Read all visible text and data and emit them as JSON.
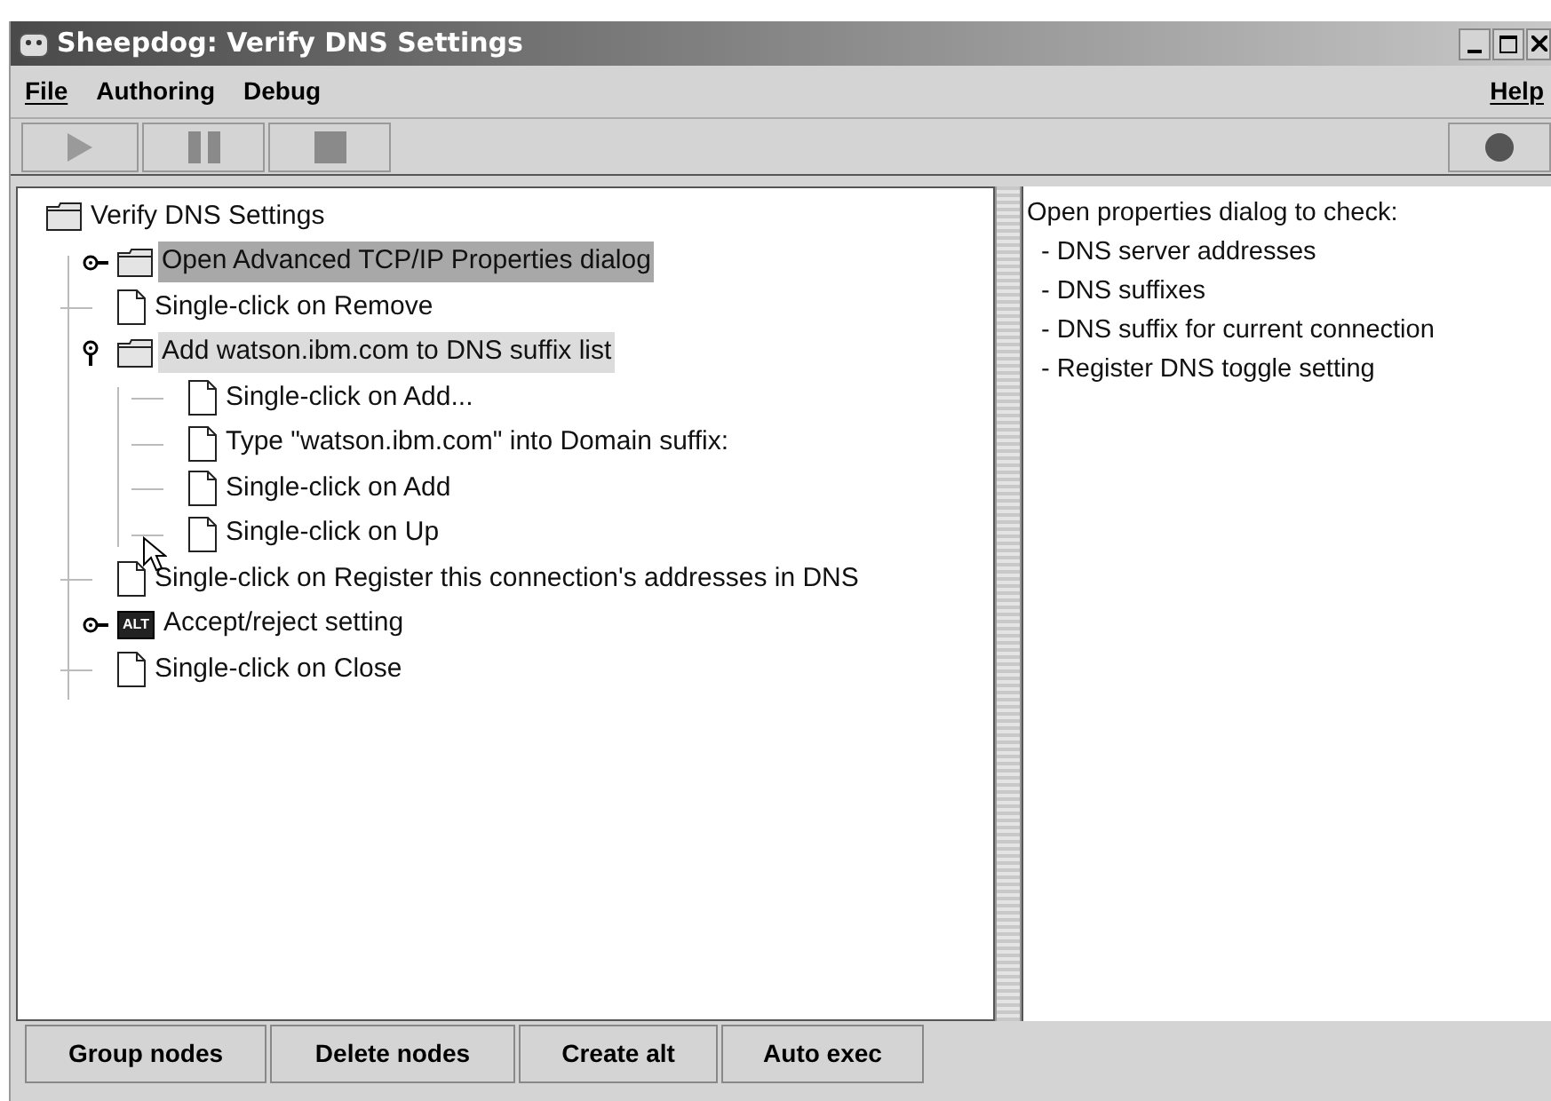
{
  "window": {
    "title": "Sheepdog: Verify DNS Settings"
  },
  "menu": [
    {
      "label": "File",
      "mnemonic": true
    },
    {
      "label": "Authoring",
      "mnemonic": false
    },
    {
      "label": "Debug",
      "mnemonic": false
    }
  ],
  "help_menu": {
    "label": "Help",
    "mnemonic": true
  },
  "tree": {
    "label": "Verify DNS Settings",
    "kind": "folder",
    "children": [
      {
        "label": "Open Advanced TCP/IP Properties dialog",
        "kind": "folder",
        "expanded": false,
        "selected": true,
        "focused": false
      },
      {
        "label": "Single-click on Remove",
        "kind": "step",
        "selected": false,
        "focused": false
      },
      {
        "label": "Add watson.ibm.com to DNS suffix list",
        "kind": "folder",
        "expanded": true,
        "selected": false,
        "focused": true,
        "children": [
          {
            "label": "Single-click on Add...",
            "kind": "step",
            "selected": false,
            "focused": false
          },
          {
            "label": "Type \"watson.ibm.com\" into Domain suffix:",
            "kind": "step",
            "selected": false,
            "focused": false
          },
          {
            "label": "Single-click on Add",
            "kind": "step",
            "selected": false,
            "focused": false
          },
          {
            "label": "Single-click on Up",
            "kind": "step",
            "selected": false,
            "focused": false
          }
        ]
      },
      {
        "label": "Single-click on Register this connection's addresses in DNS",
        "kind": "step",
        "selected": false,
        "focused": false
      },
      {
        "label": "Accept/reject setting",
        "kind": "alt",
        "alt_badge": "ALT",
        "expanded": false,
        "selected": false,
        "focused": false
      },
      {
        "label": "Single-click on Close",
        "kind": "step",
        "selected": false,
        "focused": false
      }
    ]
  },
  "description": [
    "Open properties dialog to check:",
    "  - DNS server addresses",
    "  - DNS suffixes",
    "  - DNS suffix for current connection",
    "  - Register DNS toggle setting"
  ],
  "buttons": [
    "Group nodes",
    "Delete nodes",
    "Create alt",
    "Auto exec"
  ]
}
